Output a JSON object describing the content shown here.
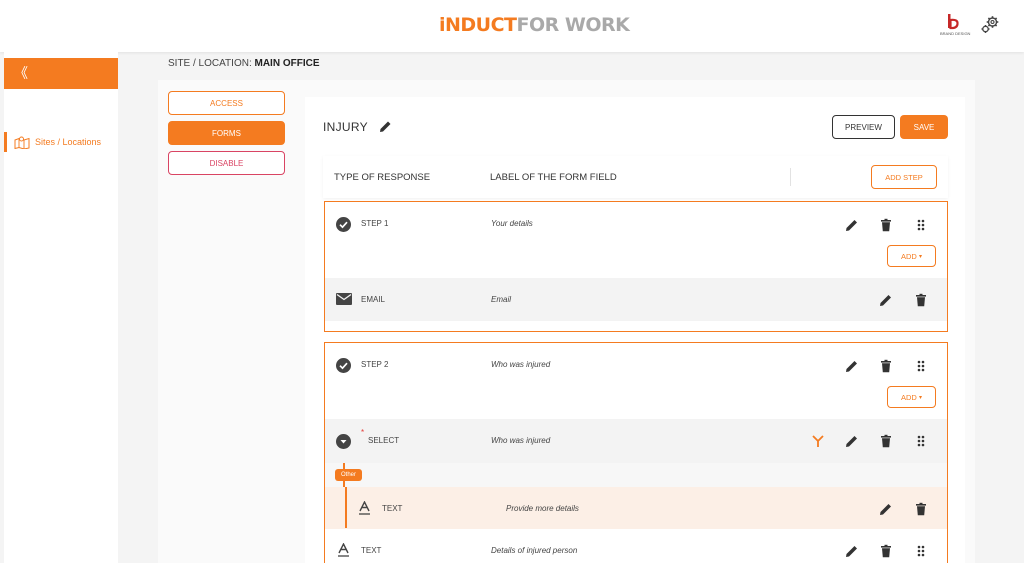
{
  "header": {
    "logo_part1": "iNDUCT",
    "logo_part2": "FOR WORK",
    "brand_text": "BRAND DESIGN"
  },
  "sidebar": {
    "collapse_glyph": "《",
    "items": [
      {
        "label": "Sites / Locations",
        "icon": "map-icon"
      }
    ]
  },
  "breadcrumb": {
    "prefix": "SITE / LOCATION:",
    "value": "MAIN OFFICE"
  },
  "leftnav": {
    "access": "ACCESS",
    "forms": "FORMS",
    "disable": "DISABLE"
  },
  "form": {
    "title": "INJURY",
    "preview": "PREVIEW",
    "save": "SAVE",
    "col_type": "TYPE OF RESPONSE",
    "col_label": "LABEL OF THE FORM FIELD",
    "add_step": "ADD STEP",
    "add": "ADD",
    "other_badge": "Other"
  },
  "steps": [
    {
      "type": "STEP 1",
      "label": "Your details",
      "fields": [
        {
          "type": "EMAIL",
          "label": "Email",
          "icon": "email-icon"
        }
      ]
    },
    {
      "type": "STEP 2",
      "label": "Who was injured",
      "fields": [
        {
          "type": "SELECT",
          "label": "Who was injured",
          "icon": "dropdown-circle-icon",
          "required": "*"
        },
        {
          "type": "TEXT",
          "label": "Provide more details",
          "icon": "text-format-icon",
          "conditional": true
        },
        {
          "type": "TEXT",
          "label": "Details of injured person",
          "icon": "text-format-icon"
        }
      ]
    }
  ],
  "colors": {
    "accent": "#f47b20",
    "danger": "#d94463",
    "logo_grey": "#a9a9a9",
    "row_grey": "#f3f3f3",
    "row_peach": "#fcefe6"
  }
}
